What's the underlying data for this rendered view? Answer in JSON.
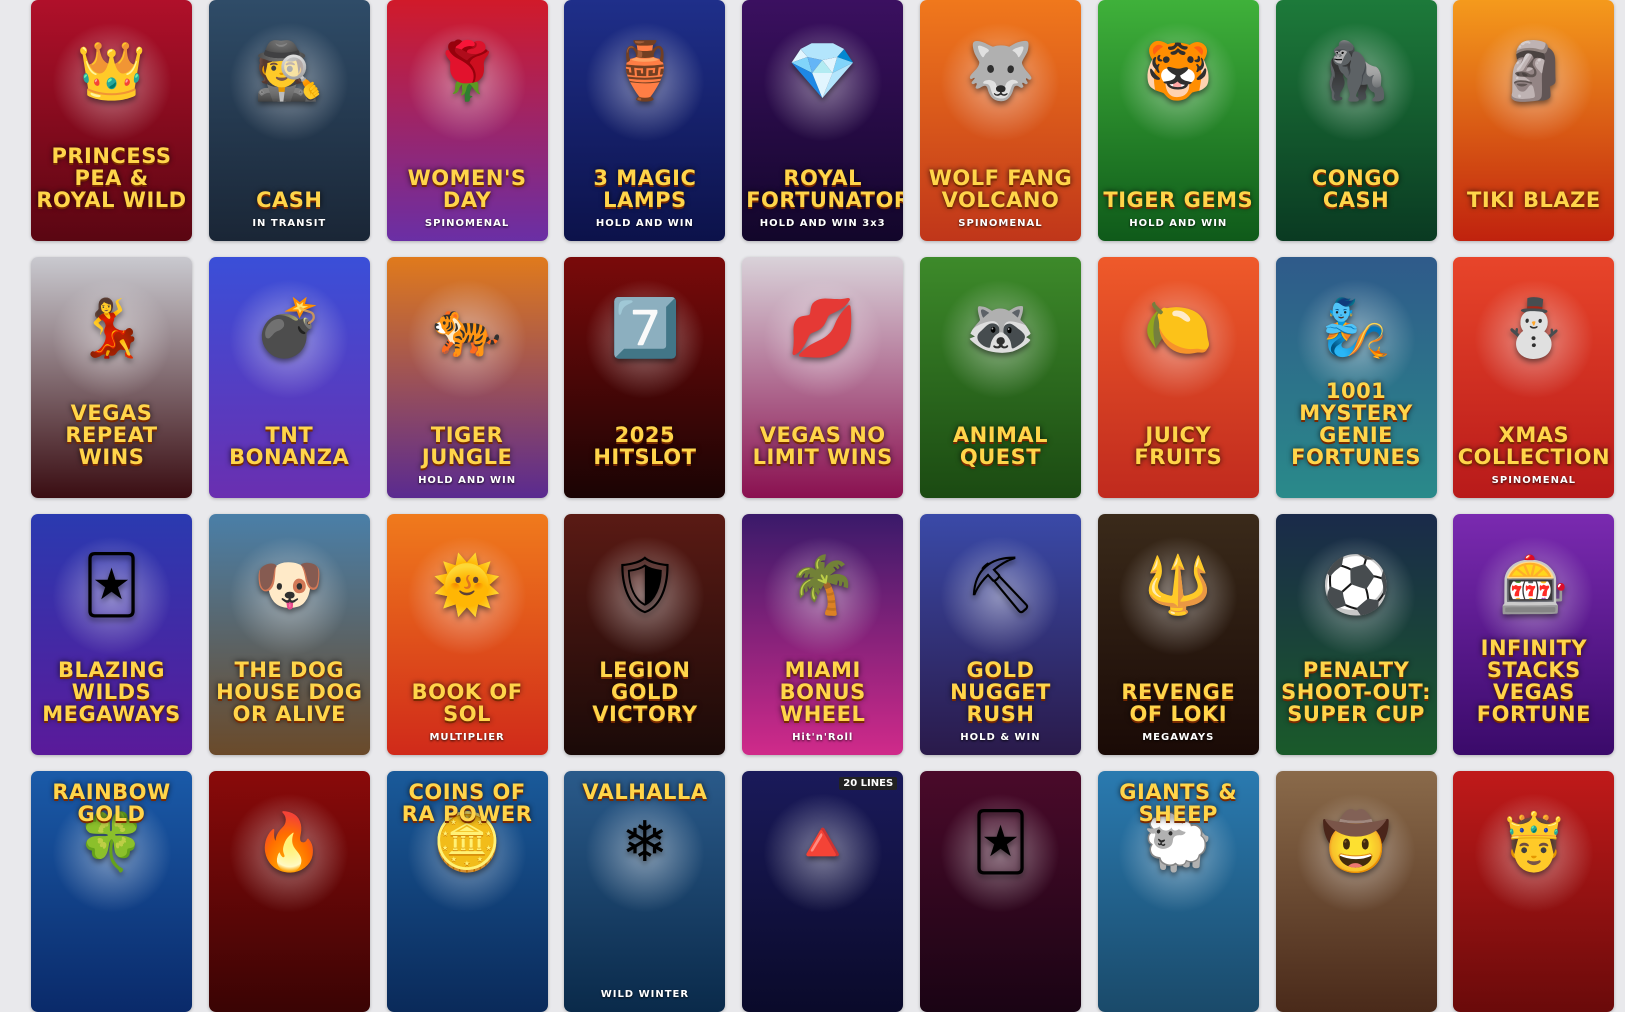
{
  "games": [
    {
      "title": "PRINCESS PEA & ROYAL WILD",
      "sub": "",
      "icon": "👑",
      "bg": [
        "#b0102a",
        "#5a0612"
      ]
    },
    {
      "title": "CASH",
      "sub": "IN TRANSIT",
      "icon": "🕵",
      "bg": [
        "#2f4c68",
        "#1a2636"
      ]
    },
    {
      "title": "WOMEN'S DAY",
      "sub": "SPINOMENAL",
      "icon": "🌹",
      "bg": [
        "#d11a2a",
        "#6a2fa5"
      ]
    },
    {
      "title": "3 Magic Lamps",
      "sub": "HOLD AND WIN",
      "icon": "🏺",
      "bg": [
        "#1f2f8a",
        "#0c124a"
      ]
    },
    {
      "title": "ROYAL FORTUNATOR",
      "sub": "HOLD AND WIN 3x3",
      "icon": "💎",
      "bg": [
        "#3b1060",
        "#12062a"
      ]
    },
    {
      "title": "WOLF FANG VOLCANO",
      "sub": "SPINOMENAL",
      "icon": "🐺",
      "bg": [
        "#f0781c",
        "#c0361a"
      ]
    },
    {
      "title": "TIGER GEMS",
      "sub": "HOLD AND WIN",
      "icon": "🐯",
      "bg": [
        "#3fb13a",
        "#0f5a1a"
      ]
    },
    {
      "title": "CONGO CASH",
      "sub": "",
      "icon": "🦍",
      "bg": [
        "#1d7a3a",
        "#0a3a22"
      ]
    },
    {
      "title": "TIKI BLAZE",
      "sub": "",
      "icon": "🗿",
      "bg": [
        "#f59a1c",
        "#c0220e"
      ]
    },
    {
      "title": "VEGAS REPEAT WINS",
      "sub": "",
      "icon": "💃",
      "bg": [
        "#c9c9cf",
        "#3a0d12"
      ]
    },
    {
      "title": "TNT BONANZA",
      "sub": "",
      "icon": "💣",
      "bg": [
        "#3a4fd8",
        "#6a2fb0"
      ]
    },
    {
      "title": "TIGER JUNGLE",
      "sub": "HOLD AND WIN",
      "icon": "🐅",
      "bg": [
        "#e07a1c",
        "#5a2a90"
      ]
    },
    {
      "title": "2025 HITSLOT",
      "sub": "",
      "icon": "7️⃣",
      "bg": [
        "#7a0a0a",
        "#1a0404"
      ]
    },
    {
      "title": "VEGAS NO LIMIT WINS",
      "sub": "",
      "icon": "💋",
      "bg": [
        "#d9d2d9",
        "#8a1050"
      ]
    },
    {
      "title": "ANIMAL QUEST",
      "sub": "",
      "icon": "🦝",
      "bg": [
        "#3d8a2a",
        "#1b4a12"
      ]
    },
    {
      "title": "Juicy Fruits",
      "sub": "",
      "icon": "🍋",
      "bg": [
        "#ef5a2a",
        "#c02a1e"
      ]
    },
    {
      "title": "1001 Mystery Genie Fortunes",
      "sub": "",
      "icon": "🧞",
      "bg": [
        "#2f5a8a",
        "#2a8a8a"
      ]
    },
    {
      "title": "XMAS COLLECTION",
      "sub": "SPINOMENAL",
      "icon": "⛄",
      "bg": [
        "#e8452a",
        "#b81a1a"
      ]
    },
    {
      "title": "BLAZING WILDS MEGAWAYS",
      "sub": "",
      "icon": "🃏",
      "bg": [
        "#2a3ab0",
        "#5a1a9a"
      ]
    },
    {
      "title": "THE DOG HOUSE DOG OR ALIVE",
      "sub": "",
      "icon": "🐶",
      "bg": [
        "#4a7fa8",
        "#6a4a2a"
      ]
    },
    {
      "title": "BOOK OF SOL",
      "sub": "MULTIPLIER",
      "icon": "🌞",
      "bg": [
        "#f07a1c",
        "#d02a1a"
      ]
    },
    {
      "title": "LEGION GOLD VICTORY",
      "sub": "",
      "icon": "🛡",
      "bg": [
        "#5a1a14",
        "#1a0a08"
      ]
    },
    {
      "title": "MIAMI BONUS WHEEL",
      "sub": "Hit'n'Roll",
      "icon": "🌴",
      "bg": [
        "#3a1a6a",
        "#d02a8a"
      ]
    },
    {
      "title": "Gold Nugget Rush",
      "sub": "HOLD & WIN",
      "icon": "⛏",
      "bg": [
        "#3a4aa8",
        "#2a1a4a"
      ]
    },
    {
      "title": "REVENGE OF LOKI",
      "sub": "MEGAWAYS",
      "icon": "🔱",
      "bg": [
        "#3a2a1a",
        "#1a0a06"
      ]
    },
    {
      "title": "PENALTY SHOOT-OUT: SUPER CUP",
      "sub": "",
      "icon": "⚽",
      "bg": [
        "#1a2a4a",
        "#1a5a2a"
      ]
    },
    {
      "title": "INFINITY STACKS Vegas Fortune",
      "sub": "",
      "icon": "🎰",
      "bg": [
        "#7a2ab0",
        "#3a0a6a"
      ]
    },
    {
      "title": "Rainbow Gold",
      "sub": "",
      "icon": "🍀",
      "bg": [
        "#1a5aa8",
        "#0a2a6a"
      ]
    },
    {
      "title": "",
      "sub": "",
      "icon": "🔥",
      "bg": [
        "#8a0a0a",
        "#3a0404"
      ]
    },
    {
      "title": "COINS OF RA POWER",
      "sub": "",
      "icon": "🪙",
      "bg": [
        "#1a5a9a",
        "#0a2a5a"
      ]
    },
    {
      "title": "VALHALLA",
      "sub": "WILD WINTER",
      "icon": "❄",
      "bg": [
        "#2a5a8a",
        "#0a2a4a"
      ]
    },
    {
      "title": "",
      "sub": "20 LINES",
      "icon": "🔺",
      "bg": [
        "#1a1a5a",
        "#0a0a2a"
      ]
    },
    {
      "title": "",
      "sub": "",
      "icon": "🃏",
      "bg": [
        "#4a0a2a",
        "#1a0414"
      ]
    },
    {
      "title": "Giants & Sheep",
      "sub": "",
      "icon": "🐑",
      "bg": [
        "#2a7ab0",
        "#1a4a6a"
      ]
    },
    {
      "title": "",
      "sub": "",
      "icon": "🤠",
      "bg": [
        "#8a6a4a",
        "#4a2a1a"
      ]
    },
    {
      "title": "",
      "sub": "",
      "icon": "🤴",
      "bg": [
        "#c01a1a",
        "#6a0a0a"
      ]
    }
  ]
}
